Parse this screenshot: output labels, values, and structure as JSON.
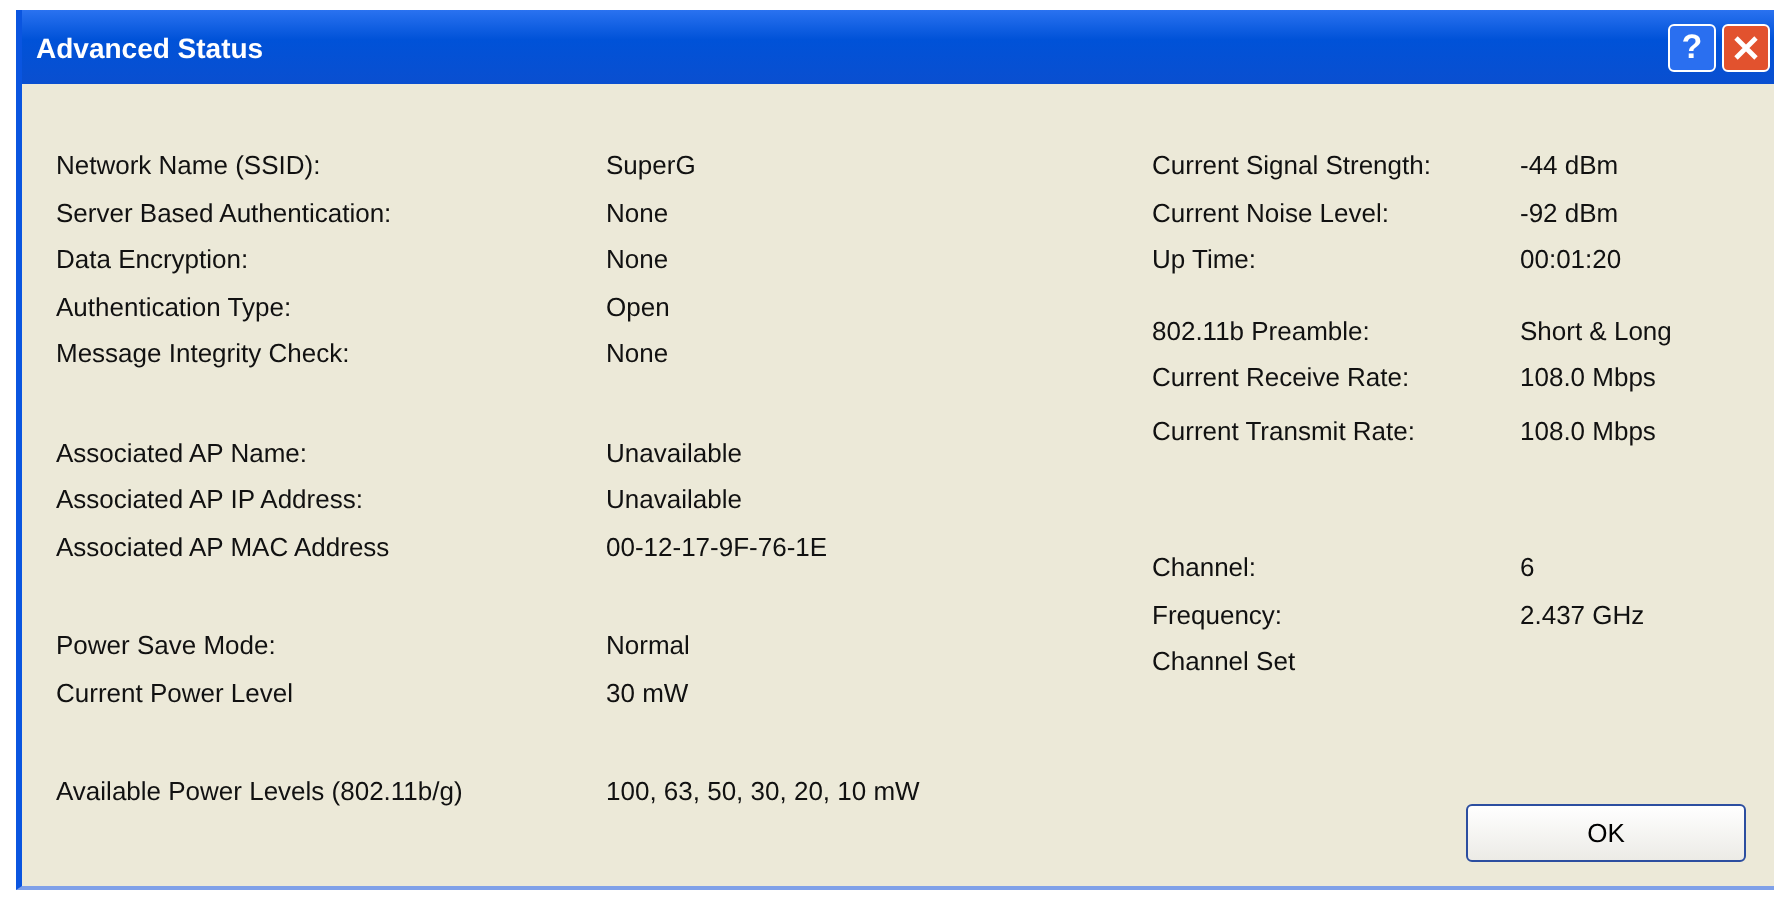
{
  "window": {
    "title": "Advanced Status",
    "help_button": "?"
  },
  "left_groups": [
    [
      {
        "label": "Network Name (SSID):",
        "value": "SuperG"
      },
      {
        "label": "Server Based Authentication:",
        "value": "None"
      },
      {
        "label": "Data Encryption:",
        "value": "None"
      },
      {
        "label": "Authentication Type:",
        "value": "Open"
      },
      {
        "label": "Message Integrity Check:",
        "value": "None"
      }
    ],
    [
      {
        "label": "Associated AP Name:",
        "value": "Unavailable"
      },
      {
        "label": "Associated AP IP Address:",
        "value": "Unavailable"
      },
      {
        "label": "Associated AP MAC Address",
        "value": "00-12-17-9F-76-1E"
      }
    ],
    [
      {
        "label": "Power Save Mode:",
        "value": "Normal"
      },
      {
        "label": "Current Power Level",
        "value": "30 mW"
      }
    ],
    [
      {
        "label": "Available Power Levels (802.11b/g)",
        "value": "100, 63, 50, 30, 20, 10 mW"
      }
    ]
  ],
  "right_groups": [
    [
      {
        "label": "Current Signal Strength:",
        "value": "-44 dBm"
      },
      {
        "label": "Current Noise Level:",
        "value": "-92 dBm"
      },
      {
        "label": "Up Time:",
        "value": "00:01:20"
      }
    ],
    [
      {
        "label": "802.11b Preamble:",
        "value": "Short & Long"
      },
      {
        "label": "Current Receive Rate:",
        "value": "108.0 Mbps"
      },
      {
        "label": "Current Transmit Rate:",
        "value": "108.0 Mbps"
      }
    ],
    [
      {
        "label": "Channel:",
        "value": "6"
      },
      {
        "label": "Frequency:",
        "value": "2.437 GHz"
      },
      {
        "label": "Channel Set"
      }
    ]
  ],
  "buttons": [
    "OK"
  ]
}
